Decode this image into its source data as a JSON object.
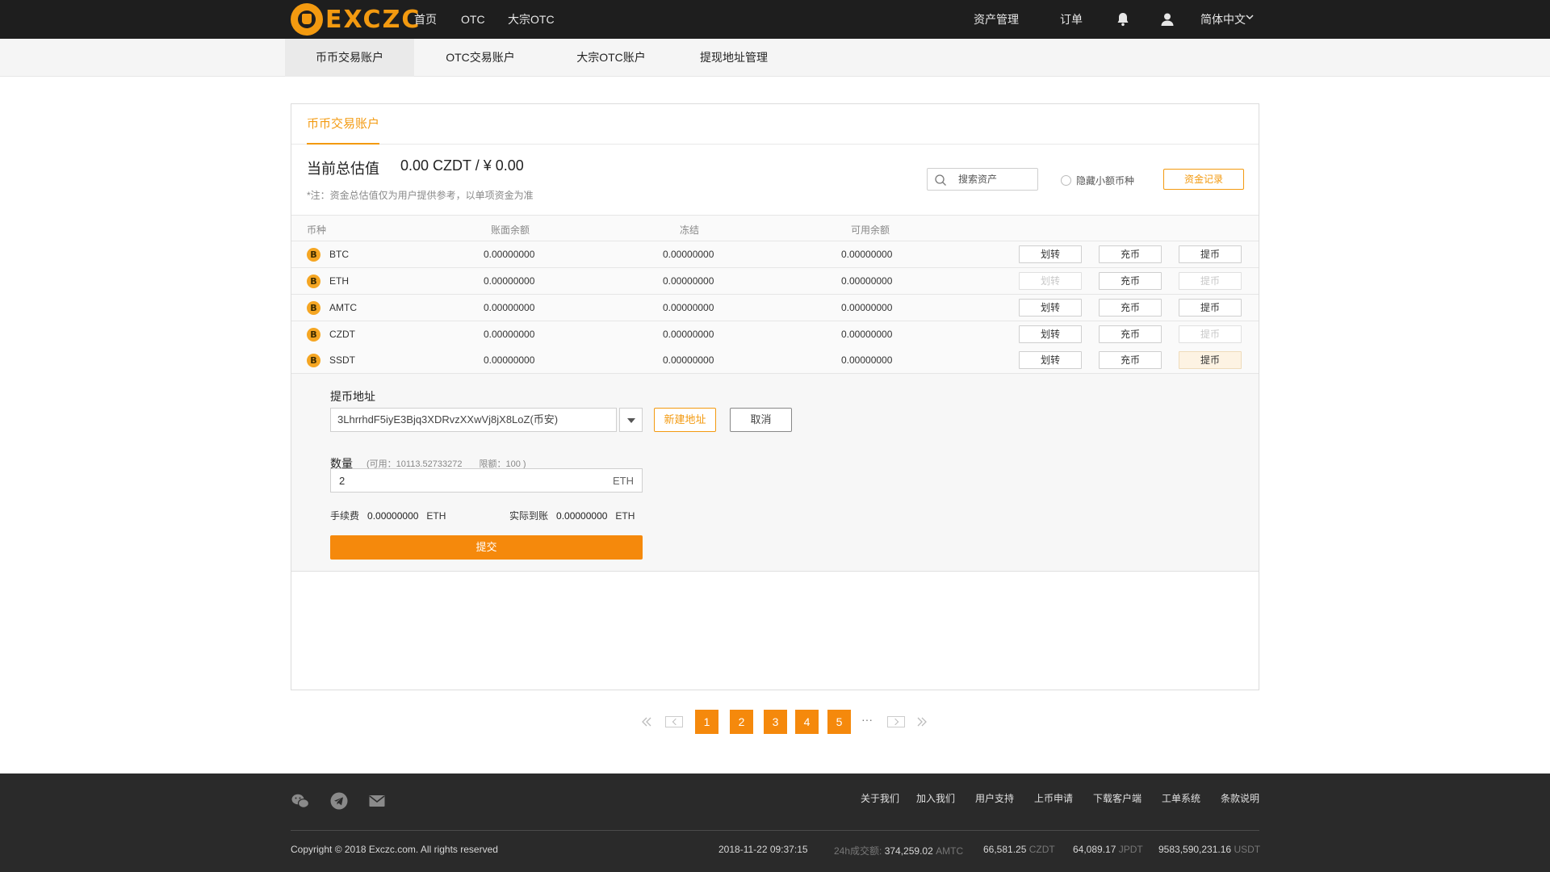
{
  "nav": {
    "brand": "EXCZC",
    "links": [
      "首页",
      "OTC",
      "大宗OTC"
    ],
    "right": {
      "assets": "资产管理",
      "orders": "订单",
      "language": "简体中文"
    }
  },
  "subnav": [
    "币币交易账户",
    "OTC交易账户",
    "大宗OTC账户",
    "提现地址管理"
  ],
  "card": {
    "tab": "币币交易账户",
    "total_label": "当前总估值",
    "total_value": "0.00 CZDT / ¥ 0.00",
    "note": "*注：资金总估值仅为用户提供参考，以单项资金为准",
    "search_placeholder": "搜索资产",
    "hide_small": "隐藏小额币种",
    "record_button": "资金记录"
  },
  "table": {
    "headers": [
      "币种",
      "账面余额",
      "冻结",
      "可用余额"
    ],
    "actions": [
      "划转",
      "充币",
      "提币"
    ],
    "rows": [
      {
        "coin": "BTC",
        "balance": "0.00000000",
        "frozen": "0.00000000",
        "available": "0.00000000",
        "transfer_disabled": false,
        "withdraw_disabled": false,
        "withdraw_active": false
      },
      {
        "coin": "ETH",
        "balance": "0.00000000",
        "frozen": "0.00000000",
        "available": "0.00000000",
        "transfer_disabled": true,
        "withdraw_disabled": true,
        "withdraw_active": false
      },
      {
        "coin": "AMTC",
        "balance": "0.00000000",
        "frozen": "0.00000000",
        "available": "0.00000000",
        "transfer_disabled": false,
        "withdraw_disabled": false,
        "withdraw_active": false
      },
      {
        "coin": "CZDT",
        "balance": "0.00000000",
        "frozen": "0.00000000",
        "available": "0.00000000",
        "transfer_disabled": false,
        "withdraw_disabled": true,
        "withdraw_active": false
      },
      {
        "coin": "SSDT",
        "balance": "0.00000000",
        "frozen": "0.00000000",
        "available": "0.00000000",
        "transfer_disabled": false,
        "withdraw_disabled": false,
        "withdraw_active": true
      }
    ]
  },
  "withdraw": {
    "address_label": "提币地址",
    "address_value": "3LhrrhdF5iyE3Bjq3XDRvzXXwVj8jX8LoZ(币安)",
    "new_address": "新建地址",
    "cancel": "取消",
    "qty_label": "数量",
    "available_hint": "(可用：10113.52733272",
    "limit_hint": "限额：100 )",
    "qty_value": "2",
    "qty_unit": "ETH",
    "fee_label": "手续费",
    "fee_value": "0.00000000",
    "fee_unit": "ETH",
    "actual_label": "实际到账",
    "actual_value": "0.00000000",
    "actual_unit": "ETH",
    "submit": "提交"
  },
  "pagination": {
    "pages": [
      "1",
      "2",
      "3",
      "4",
      "5"
    ],
    "ellipsis": "···"
  },
  "footer": {
    "links": [
      "关于我们",
      "加入我们",
      "用户支持",
      "上币申请",
      "下载客户端",
      "工单系统",
      "条款说明"
    ],
    "copyright": "Copyright © 2018 Exczc.com. All rights reserved",
    "datetime": "2018-11-22  09:37:15",
    "vol_label": "24h成交额:",
    "stats": [
      {
        "value": "374,259.02",
        "unit": "AMTC"
      },
      {
        "value": "66,581.25",
        "unit": "CZDT"
      },
      {
        "value": "64,089.17",
        "unit": "JPDT"
      },
      {
        "value": "9583,590,231.16",
        "unit": "USDT"
      }
    ]
  },
  "colors": {
    "accent": "#f5890c",
    "topbar": "#1e1e1e",
    "footer": "#2a2a2a"
  }
}
